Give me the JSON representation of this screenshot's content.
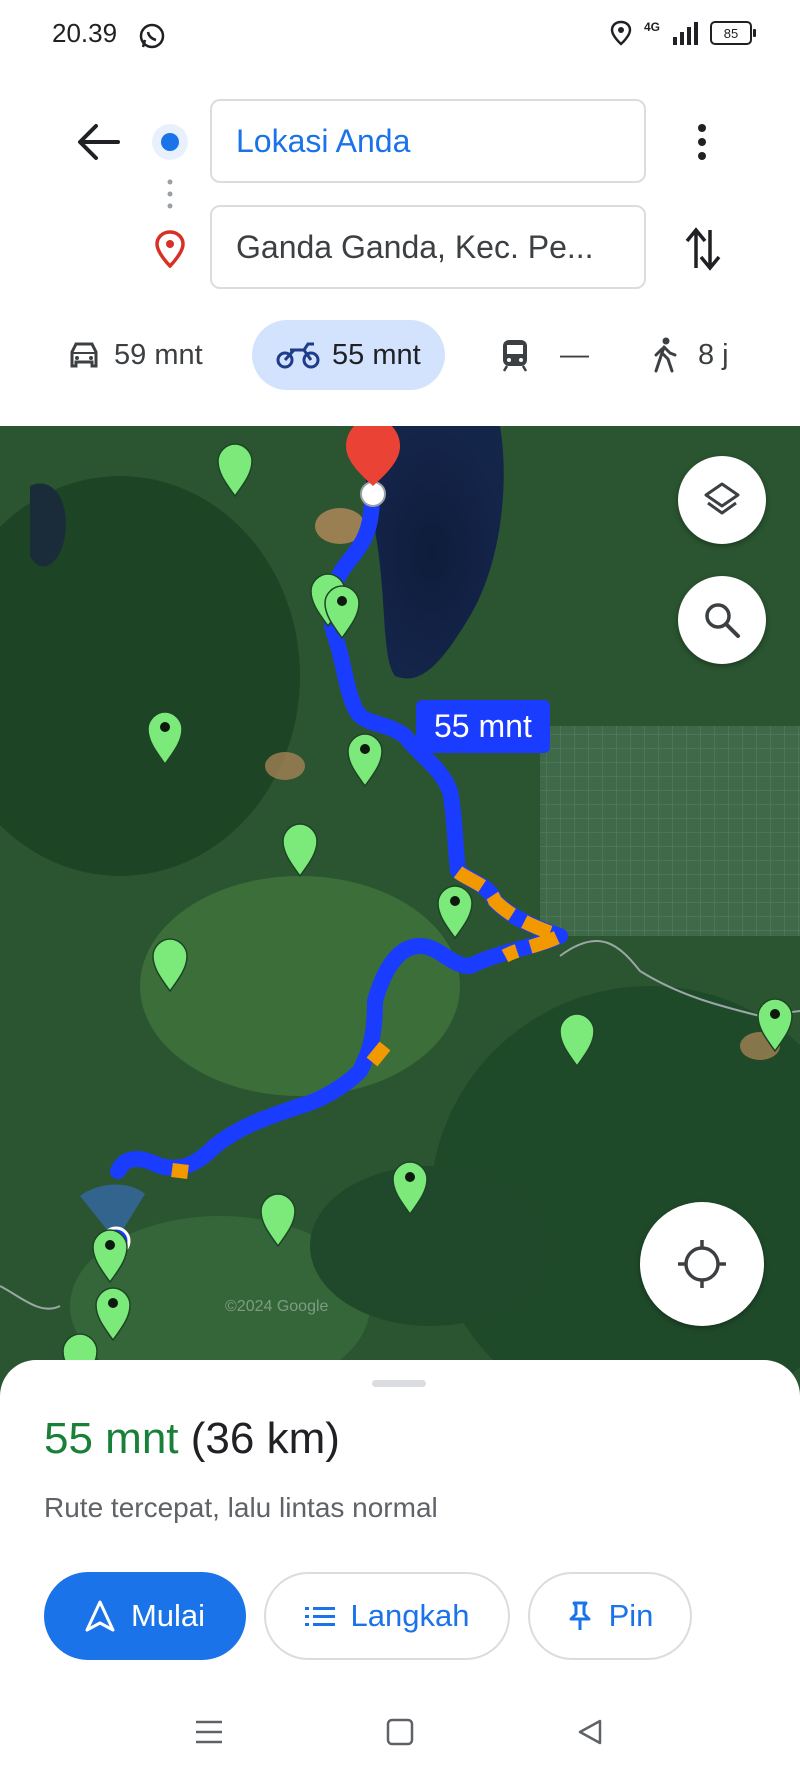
{
  "status_bar": {
    "time": "20.39",
    "signal": "4G",
    "battery": "85"
  },
  "directions": {
    "origin": "Lokasi Anda",
    "destination": "Ganda Ganda, Kec. Pe..."
  },
  "travel_modes": [
    {
      "name": "car",
      "label": "59 mnt",
      "active": false
    },
    {
      "name": "motorcycle",
      "label": "55 mnt",
      "active": true
    },
    {
      "name": "transit",
      "label": "—",
      "active": false
    },
    {
      "name": "walk",
      "label": "8 j",
      "active": false
    }
  ],
  "map": {
    "route_label": "55 mnt",
    "watermark": "©2024 Google",
    "route_color": "#1a3cff",
    "traffic_color": "#f29900",
    "pin_color": "#7bea7b"
  },
  "route_summary": {
    "duration": "55 mnt",
    "distance": "(36 km)",
    "description": "Rute tercepat, lalu lintas normal"
  },
  "actions": {
    "start": "Mulai",
    "steps": "Langkah",
    "pin": "Pin"
  },
  "icons": [
    "back-arrow-icon",
    "more-vert-icon",
    "swap-icon",
    "car-icon",
    "motorcycle-icon",
    "transit-icon",
    "walk-icon",
    "layers-icon",
    "search-icon",
    "my-location-icon",
    "navigation-icon",
    "list-icon",
    "pin-icon"
  ]
}
